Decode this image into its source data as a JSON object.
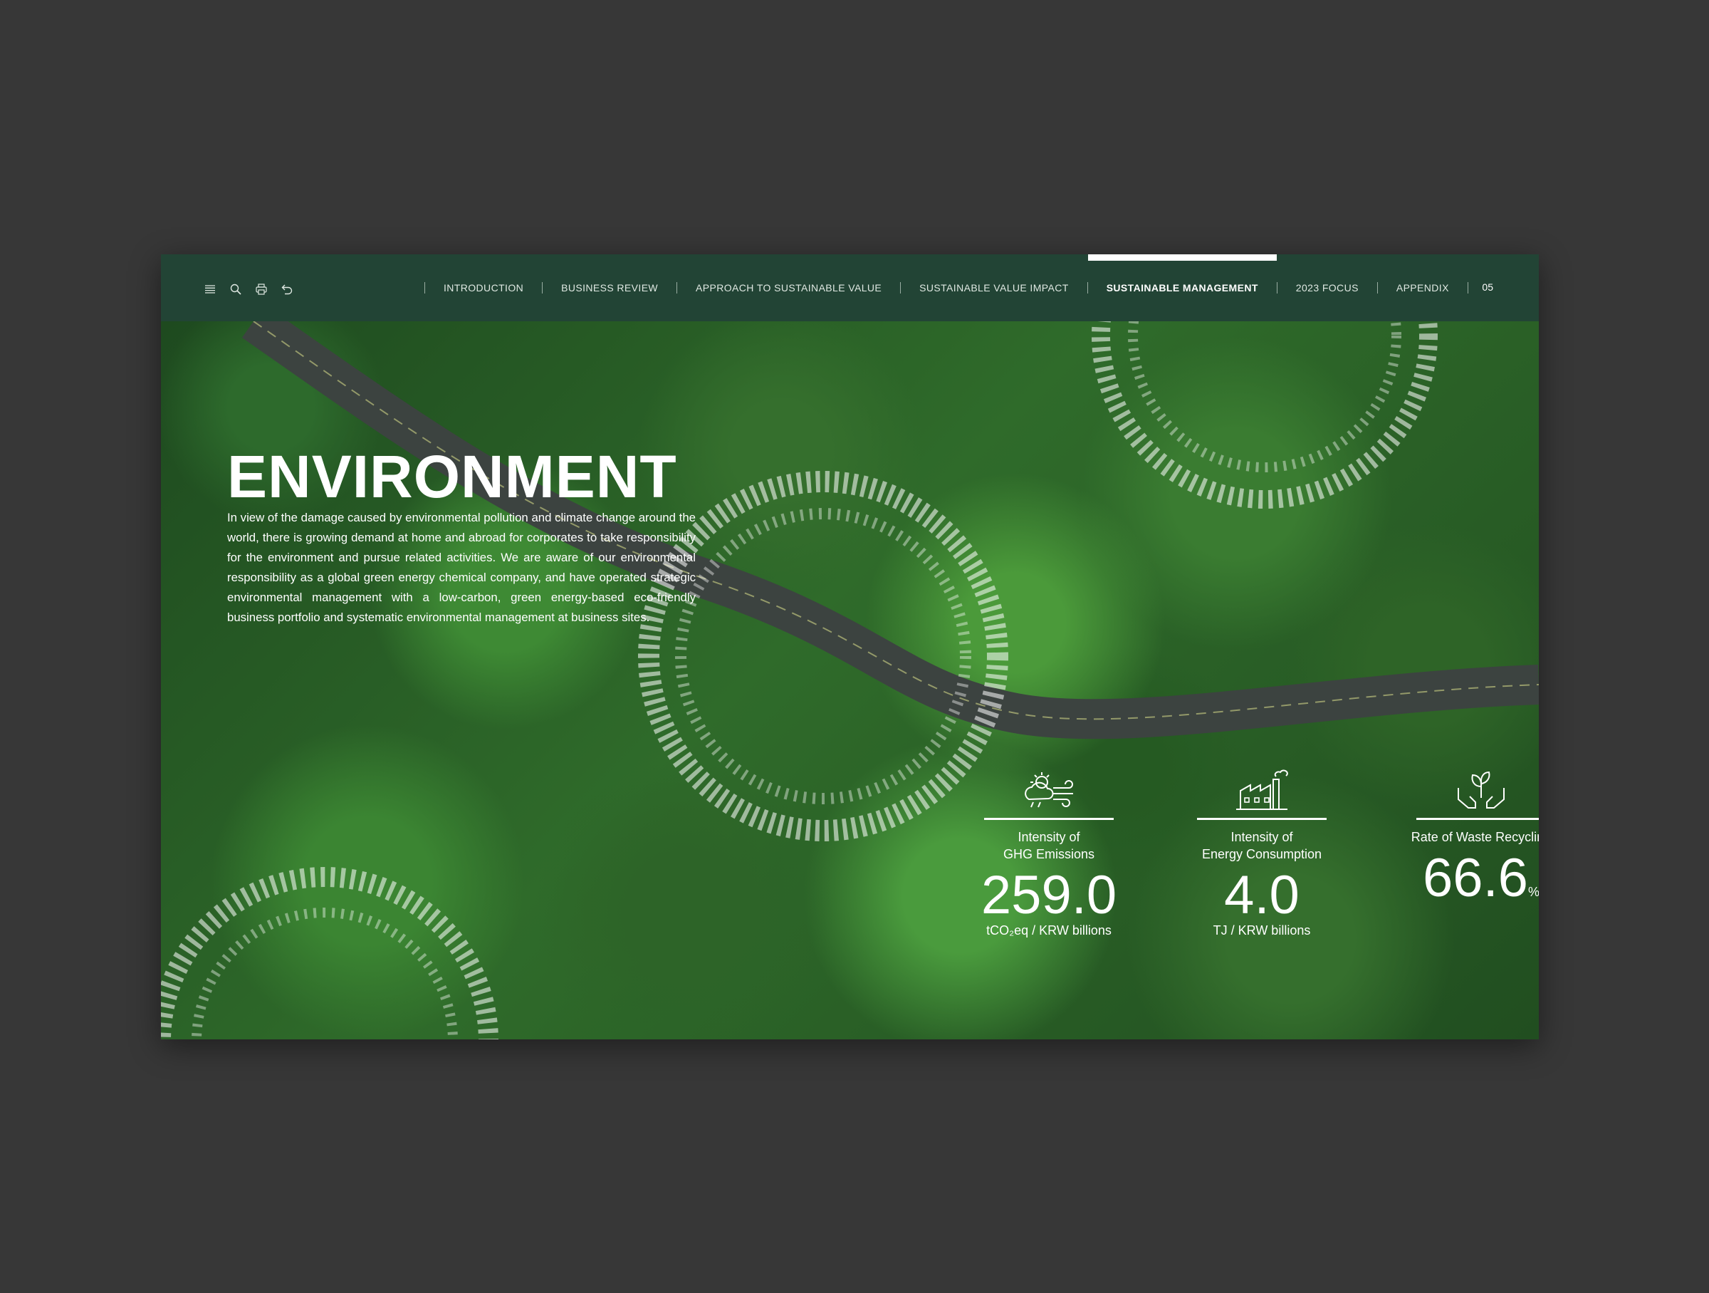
{
  "nav": {
    "items": [
      {
        "label": "INTRODUCTION"
      },
      {
        "label": "BUSINESS REVIEW"
      },
      {
        "label": "APPROACH TO SUSTAINABLE VALUE"
      },
      {
        "label": "SUSTAINABLE VALUE IMPACT"
      },
      {
        "label": "SUSTAINABLE MANAGEMENT",
        "active": true
      },
      {
        "label": "2023 FOCUS"
      },
      {
        "label": "APPENDIX"
      }
    ],
    "page_number": "05",
    "tools": [
      "menu-icon",
      "search-icon",
      "print-icon",
      "back-icon"
    ]
  },
  "hero": {
    "title": "ENVIRONMENT",
    "body": "In view of the damage caused by environmental pollution and climate change around the world, there is growing demand at home and abroad for corporates to take responsibility for the environment and pursue related activities. We are aware of our environmental responsibility as a global green energy chemical company, and have operated strategic environmental management with a low-carbon, green energy-based eco-friendly business portfolio and systematic environmental management at business sites."
  },
  "stats": [
    {
      "icon": "weather-icon",
      "label_line1": "Intensity of",
      "label_line2": "GHG Emissions",
      "value": "259.0",
      "unit": "tCO₂eq / KRW billions"
    },
    {
      "icon": "factory-icon",
      "label_line1": "Intensity of",
      "label_line2": "Energy Consumption",
      "value": "4.0",
      "unit": "TJ / KRW billions"
    },
    {
      "icon": "hands-plant-icon",
      "label_line1": "Rate of Waste Recycling",
      "label_line2": "",
      "value": "66.6",
      "value_suffix": "%"
    }
  ],
  "colors": {
    "background": "#373737",
    "topbar": "#224435",
    "accent": "#ffffff"
  }
}
